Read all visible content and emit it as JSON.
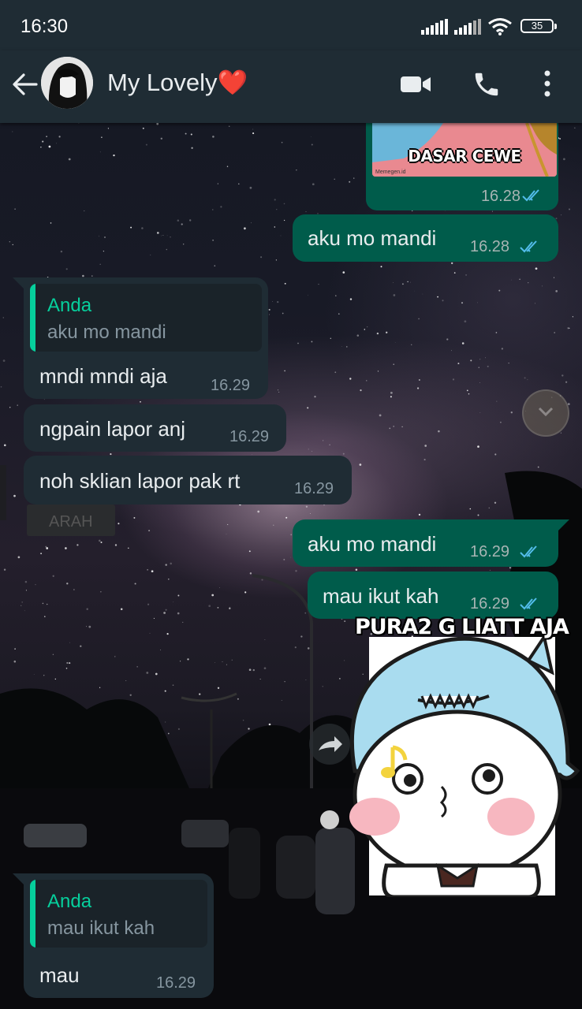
{
  "status_bar": {
    "time": "16:30",
    "battery": "35"
  },
  "header": {
    "contact_name": "My Lovely❤️"
  },
  "meme": {
    "caption": "DASAR CEWE",
    "watermark": "Memegen.id",
    "time": "16.28"
  },
  "messages": [
    {
      "id": "m1",
      "direction": "out",
      "text": "aku mo mandi",
      "time": "16.28"
    },
    {
      "id": "m2",
      "direction": "in",
      "quote_author": "Anda",
      "quote_text": "aku mo mandi",
      "text": "mndi mndi aja",
      "time": "16.29"
    },
    {
      "id": "m3",
      "direction": "in",
      "text": "ngpain lapor anj",
      "time": "16.29"
    },
    {
      "id": "m4",
      "direction": "in",
      "text": "noh sklian lapor pak rt",
      "time": "16.29"
    },
    {
      "id": "m5",
      "direction": "out",
      "text": "aku mo mandi",
      "time": "16.29"
    },
    {
      "id": "m6",
      "direction": "out",
      "text": "mau ikut kah",
      "time": "16.29"
    },
    {
      "id": "m7",
      "direction": "in",
      "quote_author": "Anda",
      "quote_text": "mau ikut kah",
      "text": "mau",
      "time": "16.29"
    }
  ],
  "sticker": {
    "caption": "PURA2 G LIATT AJA"
  },
  "background_signs": {
    "street_sign": "ARAH"
  },
  "colors": {
    "accent": "#06cf9c",
    "outgoing_bubble": "#005c4b",
    "incoming_bubble": "#1f2c34",
    "read_ticks": "#53bdeb",
    "header": "#1f2c34"
  }
}
